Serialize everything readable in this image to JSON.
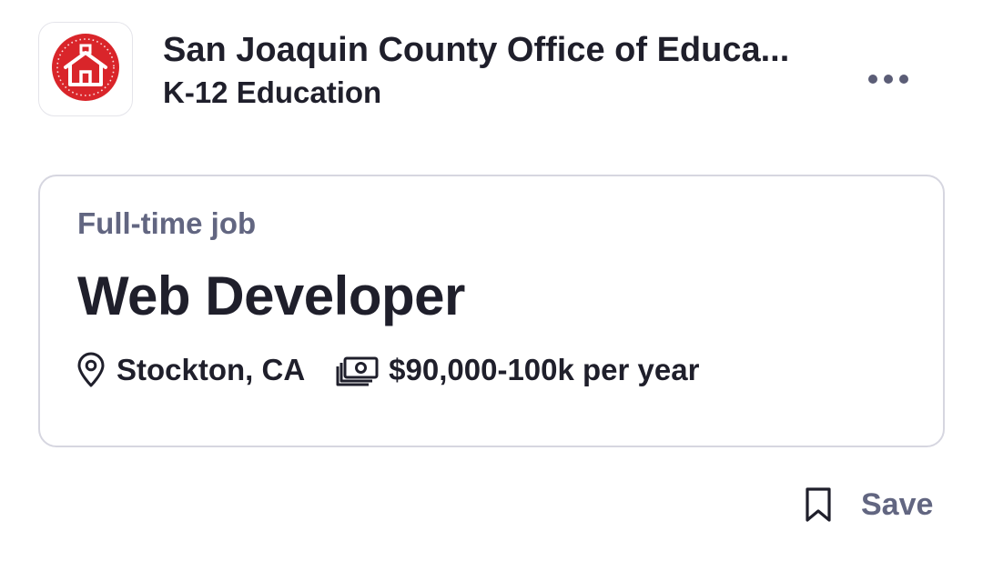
{
  "company": {
    "name": "San Joaquin County Office of Educa...",
    "industry": "K-12 Education",
    "logo_icon": "schoolhouse-icon",
    "logo_color": "#d9252a"
  },
  "header": {
    "more_icon": "more-horizontal-icon"
  },
  "job": {
    "type": "Full-time job",
    "title": "Web Developer",
    "location": "Stockton, CA",
    "location_icon": "location-pin-icon",
    "salary": "$90,000-100k per year",
    "salary_icon": "money-icon"
  },
  "actions": {
    "save_label": "Save",
    "save_icon": "bookmark-icon"
  }
}
